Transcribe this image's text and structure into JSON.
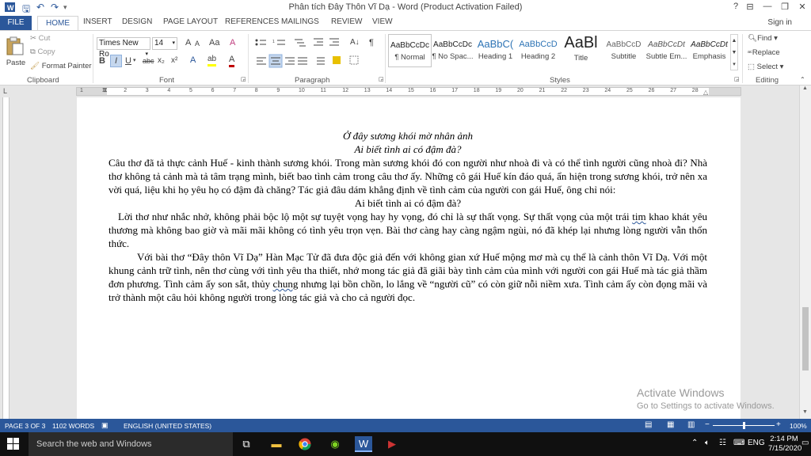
{
  "window": {
    "title": "Phân tích Đây Thôn Vĩ Dạ - Word (Product Activation Failed)",
    "help": "?",
    "minimize": "—",
    "restore": "❐",
    "close": "✕",
    "ribbon_display": "⊟"
  },
  "quick_access": {
    "save": "🖫",
    "undo": "↶",
    "redo": "↷"
  },
  "tabs": [
    "FILE",
    "HOME",
    "INSERT",
    "DESIGN",
    "PAGE LAYOUT",
    "REFERENCES",
    "MAILINGS",
    "REVIEW",
    "VIEW"
  ],
  "signin": "Sign in",
  "clipboard": {
    "paste": "Paste",
    "cut": "Cut",
    "copy": "Copy",
    "format_painter": "Format Painter",
    "label": "Clipboard"
  },
  "font": {
    "family": "Times New Ro",
    "size": "14",
    "label": "Font",
    "bold": "B",
    "italic": "I",
    "underline": "U",
    "strike": "abc",
    "subscript": "x₂",
    "superscript": "x²",
    "grow": "A",
    "shrink": "A",
    "case": "Aa",
    "clear": "A",
    "effects": "A",
    "highlight": "ab",
    "color": "A"
  },
  "paragraph": {
    "label": "Paragraph",
    "sort": "A↓",
    "show": "¶"
  },
  "styles": {
    "label": "Styles",
    "items": [
      {
        "sample": "AaBbCcDc",
        "name": "¶ Normal"
      },
      {
        "sample": "AaBbCcDc",
        "name": "¶ No Spac..."
      },
      {
        "sample": "AaBbC(",
        "name": "Heading 1"
      },
      {
        "sample": "AaBbCcD",
        "name": "Heading 2"
      },
      {
        "sample": "AaBl",
        "name": "Title"
      },
      {
        "sample": "AaBbCcD",
        "name": "Subtitle"
      },
      {
        "sample": "AaBbCcDt",
        "name": "Subtle Em..."
      },
      {
        "sample": "AaBbCcDt",
        "name": "Emphasis"
      }
    ]
  },
  "editing": {
    "find": "Find",
    "replace": "Replace",
    "select": "Select",
    "label": "Editing"
  },
  "ruler_numbers": [
    "1",
    "1",
    "2",
    "3",
    "4",
    "5",
    "6",
    "7",
    "8",
    "9",
    "10",
    "11",
    "12",
    "13",
    "14",
    "15",
    "16",
    "17",
    "18",
    "19",
    "20",
    "21",
    "22",
    "23",
    "24",
    "25",
    "26",
    "27",
    "28"
  ],
  "doc": {
    "poem1": "Ở đây sương khói mờ nhân ảnh",
    "poem2": "Ai biết tình ai có đậm đà?",
    "para1": "Câu thơ đã tả thực cảnh Huế - kinh thành sương khói. Trong màn sương khói đó con người như nhoà đi và có thể tình người cũng nhoà đi? Nhà thơ không tả cảnh mà tả tâm trạng mình, biết bao tình cảm trong câu thơ ấy. Những cô gái Huế kín đáo quá, ẩn hiện trong sương khói, trở nên xa vời quá, liệu khi họ yêu họ có đậm đà chăng? Tác giả đâu dám khẳng định về tình cảm của người con gái Huế, ông chỉ nói:",
    "quote": "Ai biết tình ai có đậm đà?",
    "para2a": "Lời thơ như nhắc nhở, không phải bộc lộ một sự tuyệt vọng hay hy vọng, đó chỉ là sự thất vọng. Sự thất vọng của một trái ",
    "para2_sq": "tim",
    "para2b": " khao khát yêu thương mà không bao giờ và mãi mãi không có tình yêu trọn vẹn. Bài thơ càng hay càng ngậm ngùi, nó đã khép lại nhưng lòng người vẫn thổn thức.",
    "para3a": "Với bài thơ “Đây thôn Vĩ Dạ” Hàn Mạc Tử đã đưa độc giả đến với không gian xứ Huế mộng mơ mà cụ thể là cảnh thôn Vĩ Dạ. Với một khung cảnh trữ tình, nên thơ cùng với tình yêu tha thiết, nhớ mong tác giả đã giãi bày tình cảm của mình với người con gái Huế mà tác giả thầm đơn phương. Tình cảm ấy son sắt, thủy ",
    "para3_sq": "chung",
    "para3b": " nhưng lại bồn chồn, lo lắng về “người cũ” có còn giữ nỗi niềm xưa. Tình cảm ấy còn đọng mãi và trở thành một câu hỏi không người trong lòng tác giả và cho cả người đọc."
  },
  "activation": {
    "line1": "Activate Windows",
    "line2": "Go to Settings to activate Windows."
  },
  "status": {
    "page": "PAGE 3 OF 3",
    "words": "1102 WORDS",
    "language": "ENGLISH (UNITED STATES)",
    "zoom": "100%",
    "zoom_level": 1.0
  },
  "taskbar": {
    "search_placeholder": "Search the web and Windows",
    "lang": "ENG",
    "time": "2:14 PM",
    "date": "7/15/2020"
  },
  "colors": {
    "accent": "#2b579a",
    "font_color": "#c00000",
    "highlight": "#ffff00"
  }
}
